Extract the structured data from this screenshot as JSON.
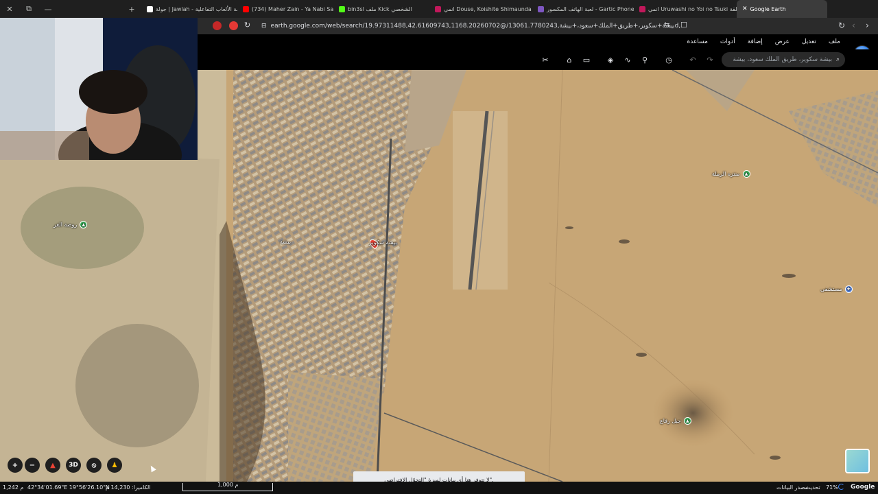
{
  "browser": {
    "tabs": [
      {
        "label": "Google Earth",
        "icon_color": "#4285f4",
        "active": true
      },
      {
        "label": "انمي Uruwashi no Yoi no Tsuki الحلقة",
        "icon_color": "#c2185b",
        "active": false
      },
      {
        "label": "لعبة الهاتف المكسور - Gartic Phone",
        "icon_color": "#7e57c2",
        "active": false
      },
      {
        "label": "انمي Douse, Koishite Shimaunda الح",
        "icon_color": "#c2185b",
        "active": false
      },
      {
        "label": "bin3sl ملف Kick الشخصي",
        "icon_color": "#53fc18",
        "active": false
      },
      {
        "label": "(734) Maher Zain - Ya Nabi Salam Al",
        "icon_color": "#ff0000",
        "active": false
      },
      {
        "label": "جولة | Jawlah - منصة الألعاب التفاعلية",
        "icon_color": "#ffffff",
        "active": false
      }
    ],
    "new_tab": "+",
    "url": "earth.google.com/web/search/19.97311488,42.61609743,1168.20260702@/بيشة+سكوير،+طريق+الملك+سعود،+بيشة,13061.7780243d,35y,0h,0t..."
  },
  "menu": {
    "items": [
      "ملف",
      "تعديل",
      "عرض",
      "إضافة",
      "أدوات",
      "مساعدة"
    ]
  },
  "search": {
    "placeholder": "بيشة سكوير، طريق الملك سعود، بيشة"
  },
  "placemarks": [
    {
      "label": "بيشة سكوير",
      "type": "selected"
    },
    {
      "label": "بيشة",
      "type": "city"
    },
    {
      "label": "منتزه الرملة",
      "type": "park"
    },
    {
      "label": "روضة الغر",
      "type": "park"
    },
    {
      "label": "مستشفى",
      "type": "hospital"
    },
    {
      "label": "جبل رفاع",
      "type": "park"
    }
  ],
  "map_controls": {
    "zoom_in": "+",
    "zoom_out": "−",
    "view_3d": "3D"
  },
  "scale": {
    "label": "1,000 م"
  },
  "toast": {
    "text": "لا تتوفر هنا أي بيانات لميزة \"التجوّل الافتراضي\"."
  },
  "status": {
    "coords": "42°34'01.69\"E 19°56'26.10\"N",
    "elevation": "1,242 م",
    "camera": "الكاميرا: 14,230 م",
    "brand": "Google",
    "loading": "71%",
    "update": "تحديث",
    "data_source": "مصدر البيانات"
  },
  "colors": {
    "accent": "#4285f4",
    "placemark_green": "#34a853",
    "selected_pin": "#ea4335"
  }
}
